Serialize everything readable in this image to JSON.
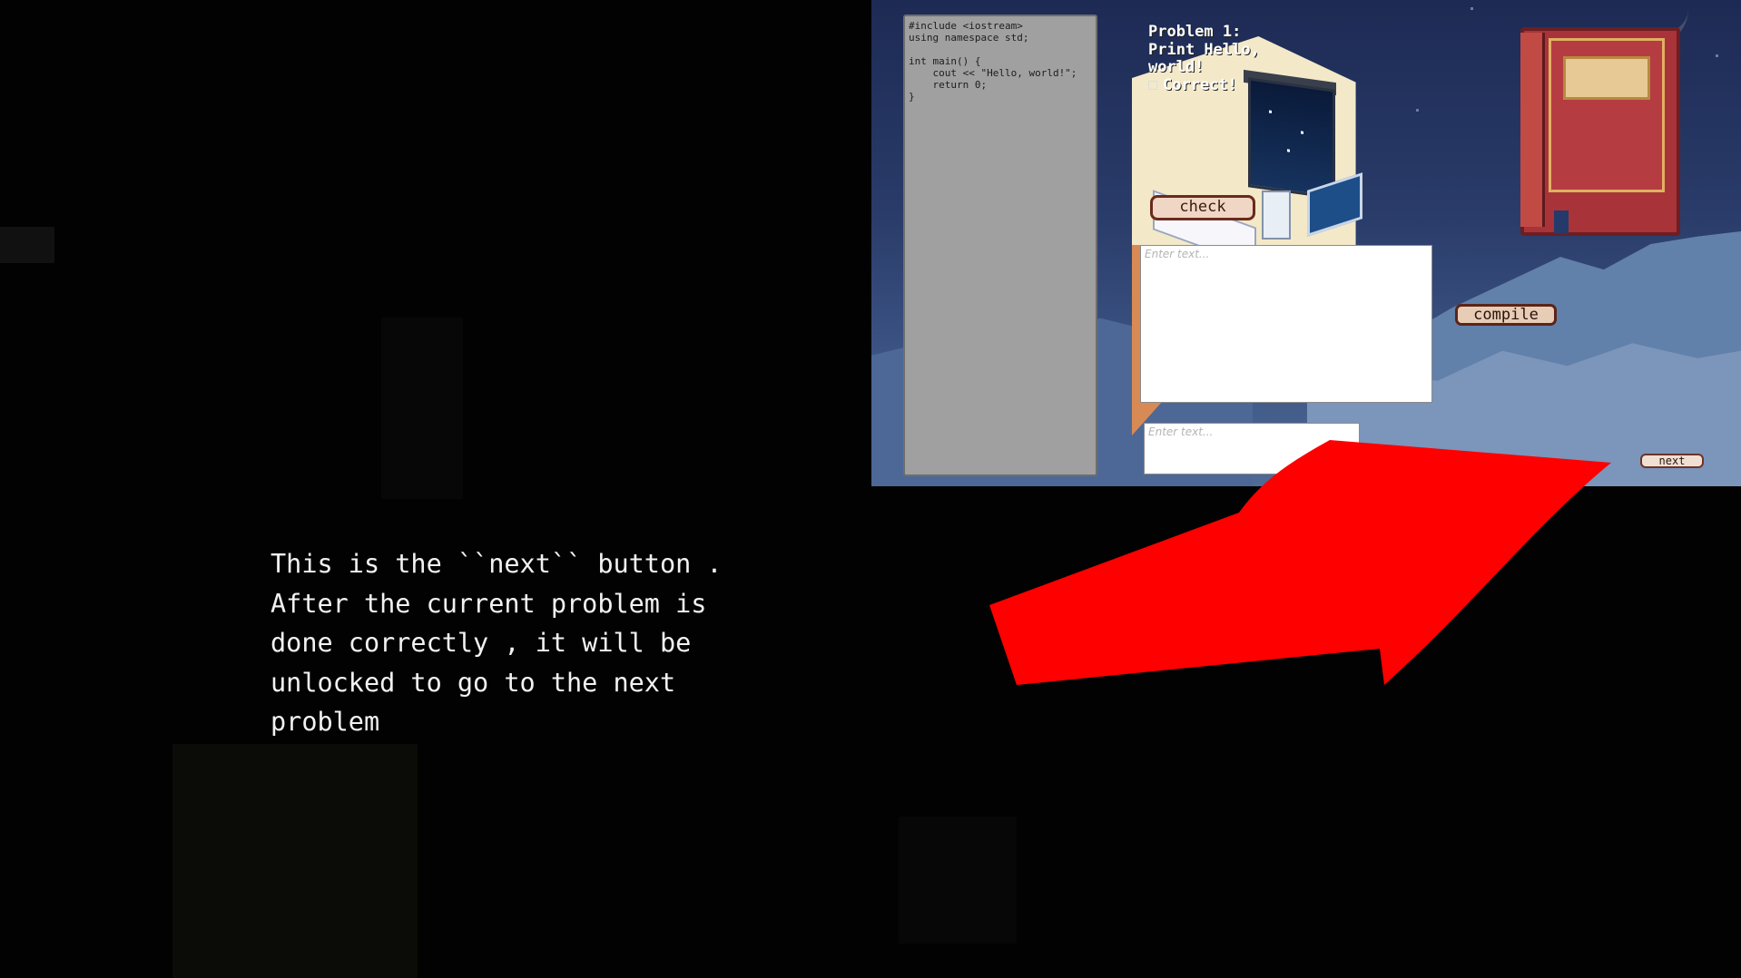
{
  "game": {
    "code": "#include <iostream>\nusing namespace std;\n\nint main() {\n    cout << \"Hello, world!\";\n    return 0;\n}",
    "problem_lines": [
      "Problem 1:",
      "Print Hello,",
      "world!"
    ],
    "correct_label": "Correct!",
    "check_label": "check",
    "compile_label": "compile",
    "next_label": "next",
    "input_placeholder": "Enter text...",
    "output_placeholder": "Enter text..."
  },
  "caption": "This is the ``next`` button .\nAfter the current problem is\ndone correctly , it will be\nunlocked to go to the next\nproblem",
  "colors": {
    "arrow": "#ff0000",
    "background": "#020202",
    "caption_text": "#f2f2f2"
  }
}
